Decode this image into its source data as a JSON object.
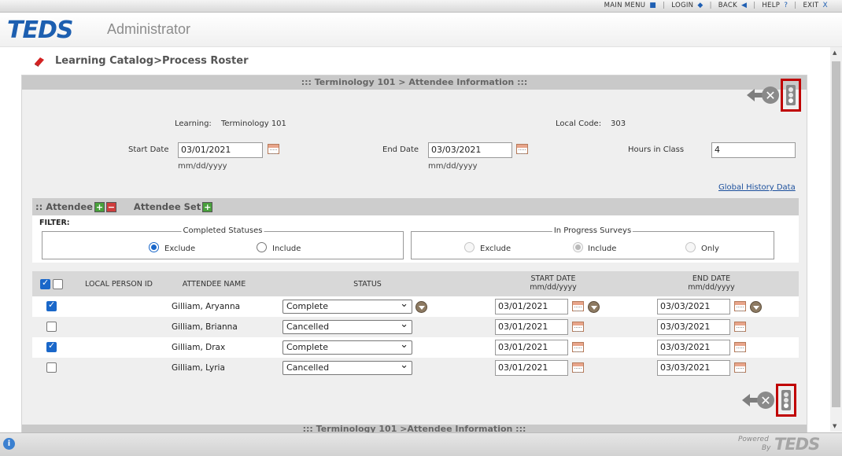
{
  "topmenu": {
    "main_menu": "MAIN MENU",
    "login": "LOGIN",
    "back": "BACK",
    "help": "HELP",
    "help_glyph": "?",
    "exit": "EXIT",
    "exit_glyph": "X"
  },
  "header": {
    "logo": "TEDS",
    "subtitle": "Administrator"
  },
  "page": {
    "title": "Learning Catalog>Process Roster"
  },
  "panel": {
    "title": "::: Terminology 101 > Attendee Information :::",
    "footer_title": "::: Terminology 101 >Attendee Information :::"
  },
  "form": {
    "learning_label": "Learning:",
    "learning_value": "Terminology 101",
    "local_code_label": "Local Code:",
    "local_code_value": "303",
    "start_date_label": "Start Date",
    "start_date_value": "03/01/2021",
    "end_date_label": "End Date",
    "end_date_value": "03/03/2021",
    "hours_label": "Hours in Class",
    "hours_value": "4",
    "date_hint": "mm/dd/yyyy",
    "global_history_link": "Global History Data"
  },
  "section": {
    "attendee_label": ":: Attendee",
    "attendee_set_label": "Attendee Set",
    "plus": "+",
    "minus": "−"
  },
  "filter": {
    "label": "FILTER:",
    "completed_statuses": {
      "legend": "Completed Statuses",
      "options": [
        "Exclude",
        "Include"
      ],
      "selected": "Exclude"
    },
    "in_progress_surveys": {
      "legend": "In Progress Surveys",
      "options": [
        "Exclude",
        "Include",
        "Only"
      ],
      "selected": "Include",
      "disabled": true
    }
  },
  "grid": {
    "columns": {
      "local_person_id": "LOCAL PERSON ID",
      "attendee_name": "ATTENDEE NAME",
      "status": "STATUS",
      "start_date": "START DATE",
      "end_date": "END DATE",
      "date_format": "mm/dd/yyyy"
    },
    "rows": [
      {
        "checked": true,
        "name": "Gilliam, Aryanna",
        "status": "Complete",
        "start": "03/01/2021",
        "end": "03/03/2021"
      },
      {
        "checked": false,
        "name": "Gilliam, Brianna",
        "status": "Cancelled",
        "start": "03/01/2021",
        "end": "03/03/2021"
      },
      {
        "checked": true,
        "name": "Gilliam, Drax",
        "status": "Complete",
        "start": "03/01/2021",
        "end": "03/03/2021"
      },
      {
        "checked": false,
        "name": "Gilliam, Lyria",
        "status": "Cancelled",
        "start": "03/01/2021",
        "end": "03/03/2021"
      }
    ]
  },
  "footer": {
    "powered": "Powered",
    "by": "By",
    "logo": "TEDS",
    "info_glyph": "i"
  },
  "colors": {
    "brand_blue": "#1d5fb0",
    "highlight_red": "#c00000",
    "checkbox_blue": "#1a67c9"
  },
  "icons": {
    "back": "back-arrow-icon",
    "cancel": "cancel-x-icon",
    "submit": "traffic-light-icon",
    "calendar": "calendar-icon",
    "dropdown": "dropdown-circle-icon"
  }
}
